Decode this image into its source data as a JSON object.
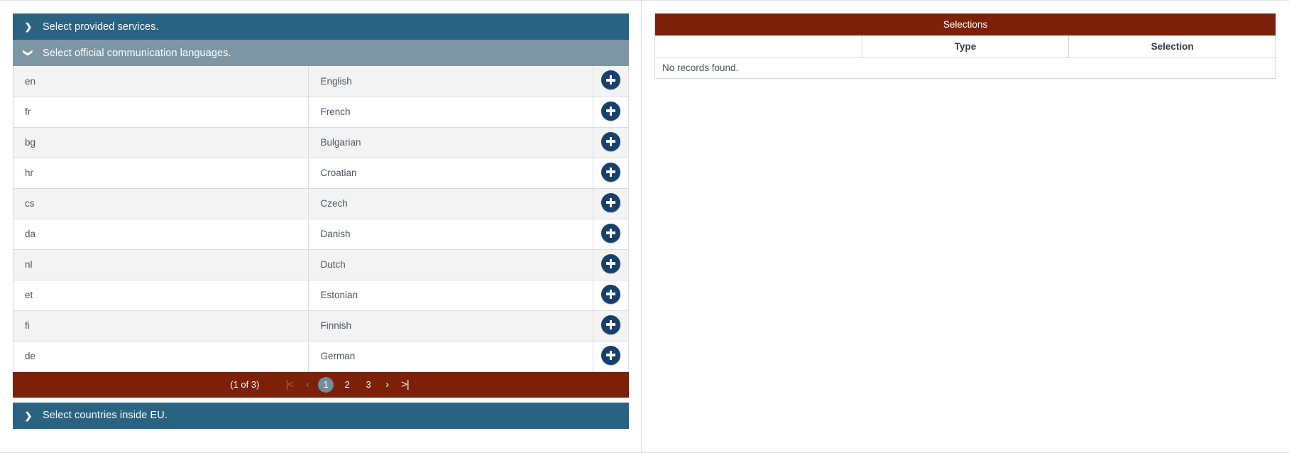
{
  "left": {
    "accordion_services": {
      "label": "Select provided services.",
      "chevron": "chevron-right",
      "state": "collapsed"
    },
    "accordion_languages": {
      "label": "Select official communication languages.",
      "chevron": "chevron-down",
      "state": "expanded"
    },
    "accordion_countries": {
      "label": "Select countries inside EU.",
      "chevron": "chevron-right",
      "state": "collapsed"
    },
    "language_rows": [
      {
        "code": "en",
        "name": "English"
      },
      {
        "code": "fr",
        "name": "French"
      },
      {
        "code": "bg",
        "name": "Bulgarian"
      },
      {
        "code": "hr",
        "name": "Croatian"
      },
      {
        "code": "cs",
        "name": "Czech"
      },
      {
        "code": "da",
        "name": "Danish"
      },
      {
        "code": "nl",
        "name": "Dutch"
      },
      {
        "code": "et",
        "name": "Estonian"
      },
      {
        "code": "fi",
        "name": "Finnish"
      },
      {
        "code": "de",
        "name": "German"
      }
    ],
    "add_button_icon": "plus-icon",
    "paginator": {
      "count_label": "(1 of 3)",
      "first_icon": "|<",
      "prev_icon": "‹",
      "pages": [
        "1",
        "2",
        "3"
      ],
      "active_page": "1",
      "next_icon": "›",
      "last_icon": ">|"
    }
  },
  "right": {
    "title": "Selections",
    "columns": [
      "",
      "Type",
      "Selection"
    ],
    "empty_message": "No records found."
  },
  "colors": {
    "accent_blue": "#2a6382",
    "accent_blue_light": "#7e96a3",
    "accent_red": "#7c2008",
    "add_button": "#17406b",
    "active_page": "#6f8d9c"
  }
}
